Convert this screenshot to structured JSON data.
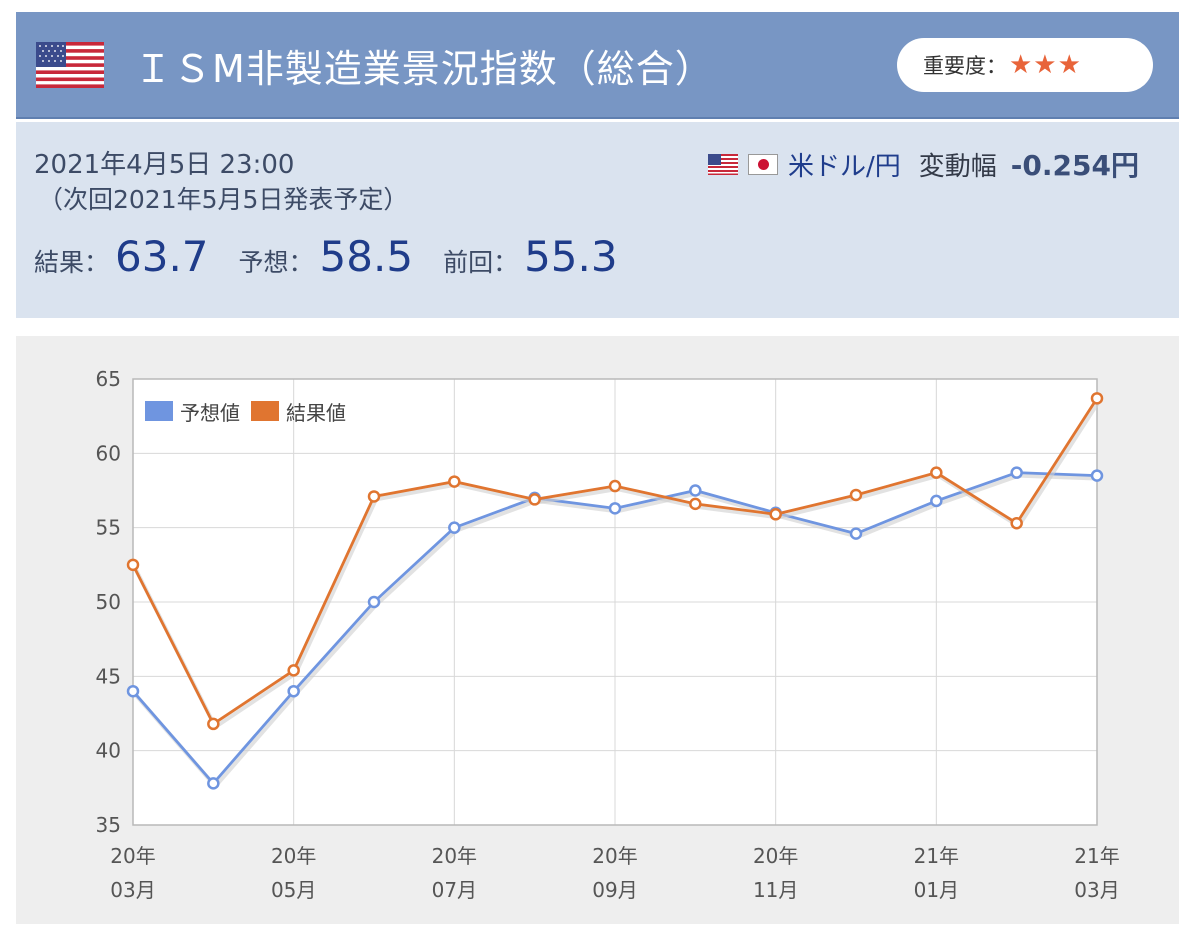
{
  "header": {
    "title": "ＩＳM非製造業景況指数（総合）",
    "importance_label": "重要度：",
    "importance_stars": "★★★",
    "importance_level": 3,
    "bg_color": "#7896c4"
  },
  "info": {
    "datetime": "2021年4月5日 23:00",
    "next_release": "（次回2021年5月5日発表予定）",
    "currency_pair": "米ドル/円",
    "change_label": "変動幅",
    "change_value": "-0.254円",
    "result_label": "結果：",
    "result_value": "63.7",
    "forecast_label": "予想：",
    "forecast_value": "58.5",
    "previous_label": "前回：",
    "previous_value": "55.3",
    "icons": [
      "us-flag-icon",
      "jp-flag-icon"
    ]
  },
  "chart_data": {
    "type": "line",
    "categories": [
      "20年03月",
      "20年04月",
      "20年05月",
      "20年06月",
      "20年07月",
      "20年08月",
      "20年09月",
      "20年10月",
      "20年11月",
      "20年12月",
      "21年01月",
      "21年02月",
      "21年03月"
    ],
    "x_tick_labels": [
      {
        "line1": "20年",
        "line2": "03月"
      },
      {
        "line1": "20年",
        "line2": "05月"
      },
      {
        "line1": "20年",
        "line2": "07月"
      },
      {
        "line1": "20年",
        "line2": "09月"
      },
      {
        "line1": "20年",
        "line2": "11月"
      },
      {
        "line1": "21年",
        "line2": "01月"
      },
      {
        "line1": "21年",
        "line2": "03月"
      }
    ],
    "series": [
      {
        "name": "予想値",
        "color": "#6f95e0",
        "values": [
          44.0,
          37.8,
          44.0,
          50.0,
          55.0,
          57.0,
          56.3,
          57.5,
          56.0,
          54.6,
          56.8,
          58.7,
          58.5
        ]
      },
      {
        "name": "結果値",
        "color": "#e07530",
        "values": [
          52.5,
          41.8,
          45.4,
          57.1,
          58.1,
          56.9,
          57.8,
          56.6,
          55.9,
          57.2,
          58.7,
          55.3,
          63.7
        ]
      }
    ],
    "ylim": [
      35,
      65
    ],
    "yticks": [
      35,
      40,
      45,
      50,
      55,
      60,
      65
    ],
    "grid": true,
    "legend_position": "top-left"
  }
}
